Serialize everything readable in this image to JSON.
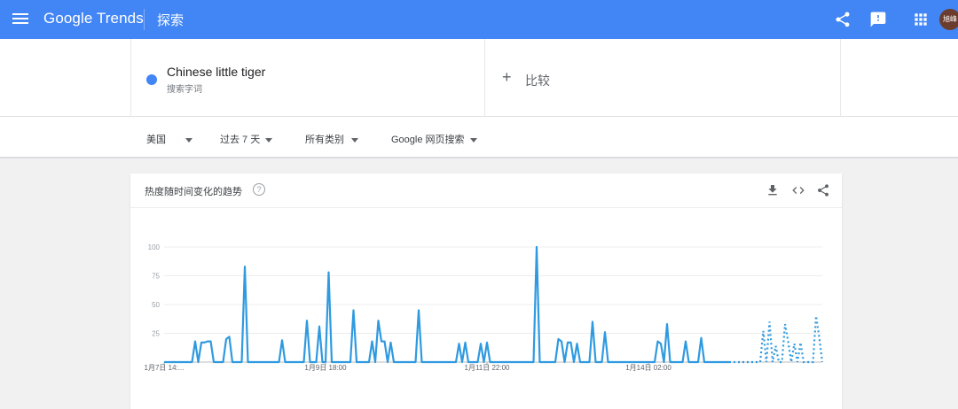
{
  "header": {
    "logo_text": "Google Trends",
    "page_label": "探索",
    "avatar_text": "旭峰"
  },
  "search": {
    "term": "Chinese little tiger",
    "term_type": "搜索字词",
    "compare_label": "比较"
  },
  "filters": {
    "region": "美国",
    "time_range": "过去 7 天",
    "category": "所有类别",
    "search_type": "Google 网页搜索"
  },
  "chart_card": {
    "title": "热度随时间变化的趋势",
    "help": "?"
  },
  "colors": {
    "brand_blue": "#4285f4",
    "series_line": "#2f9ae0"
  },
  "chart_data": {
    "type": "line",
    "title": "",
    "ylim": [
      0,
      100
    ],
    "y_ticks": [
      25,
      50,
      75,
      100
    ],
    "x_tick_labels": [
      {
        "label": "1月7日 14:...",
        "index": 0
      },
      {
        "label": "1月9日 18:00",
        "index": 52
      },
      {
        "label": "1月11日 22:00",
        "index": 104
      },
      {
        "label": "1月14日 02:00",
        "index": 156
      }
    ],
    "grid": true,
    "series": [
      {
        "values": [
          0,
          0,
          0,
          0,
          0,
          0,
          0,
          0,
          0,
          0,
          18,
          0,
          17,
          17,
          18,
          18,
          0,
          0,
          0,
          0,
          20,
          22,
          0,
          0,
          0,
          0,
          83,
          0,
          0,
          0,
          0,
          0,
          0,
          0,
          0,
          0,
          0,
          0,
          19,
          0,
          0,
          0,
          0,
          0,
          0,
          0,
          36,
          0,
          0,
          0,
          31,
          0,
          0,
          78,
          0,
          0,
          0,
          0,
          0,
          0,
          0,
          45,
          0,
          0,
          0,
          0,
          0,
          18,
          0,
          36,
          18,
          18,
          0,
          17,
          0,
          0,
          0,
          0,
          0,
          0,
          0,
          0,
          45,
          0,
          0,
          0,
          0,
          0,
          0,
          0,
          0,
          0,
          0,
          0,
          0,
          16,
          0,
          17,
          0,
          0,
          0,
          0,
          16,
          0,
          17,
          0,
          0,
          0,
          0,
          0,
          0,
          0,
          0,
          0,
          0,
          0,
          0,
          0,
          0,
          0,
          100,
          0,
          0,
          0,
          0,
          0,
          0,
          20,
          18,
          0,
          17,
          17,
          0,
          16,
          0,
          0,
          0,
          0,
          35,
          0,
          0,
          0,
          26,
          0,
          0,
          0,
          0,
          0,
          0,
          0,
          0,
          0,
          0,
          0,
          0,
          0,
          0,
          0,
          0,
          18,
          16,
          0,
          33,
          0,
          0,
          0,
          0,
          0,
          18,
          0,
          0,
          0,
          0,
          21,
          0,
          0,
          0,
          0,
          0,
          0,
          0,
          0,
          0,
          0,
          0,
          0,
          0,
          0,
          0,
          0,
          0,
          0,
          0,
          27,
          0,
          35,
          0,
          14,
          0,
          0,
          33,
          18,
          0,
          16,
          0,
          17,
          0,
          0,
          0,
          0,
          40,
          22,
          0
        ],
        "partial_from_index": 182
      }
    ]
  }
}
